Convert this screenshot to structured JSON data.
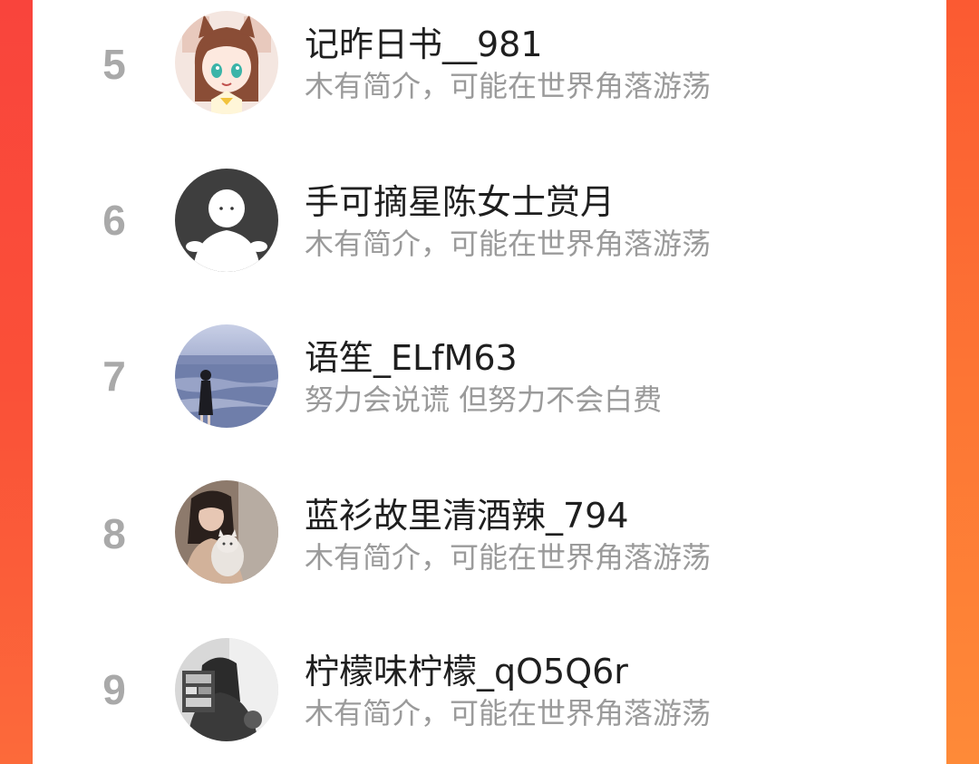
{
  "ranking": {
    "items": [
      {
        "rank": "5",
        "name": "记昨日书__981",
        "bio": "木有简介，可能在世界角落游荡",
        "avatar": "anime-girl-avatar"
      },
      {
        "rank": "6",
        "name": "手可摘星陈女士赏月",
        "bio": "木有简介，可能在世界角落游荡",
        "avatar": "default-user-avatar"
      },
      {
        "rank": "7",
        "name": "语笙_ELfM63",
        "bio": "努力会说谎 但努力不会白费",
        "avatar": "beach-photo-avatar"
      },
      {
        "rank": "8",
        "name": "蓝衫故里清酒辣_794",
        "bio": "木有简介，可能在世界角落游荡",
        "avatar": "girl-with-cat-avatar"
      },
      {
        "rank": "9",
        "name": "柠檬味柠檬_qO5Q6r",
        "bio": "木有简介，可能在世界角落游荡",
        "avatar": "bw-photo-avatar"
      }
    ]
  },
  "colors": {
    "background_red": "#fb4a3c",
    "background_orange": "#fe8a38",
    "card": "#ffffff",
    "rank": "#a9a9a9",
    "name": "#1f1f1f",
    "bio": "#9a9a9a"
  }
}
